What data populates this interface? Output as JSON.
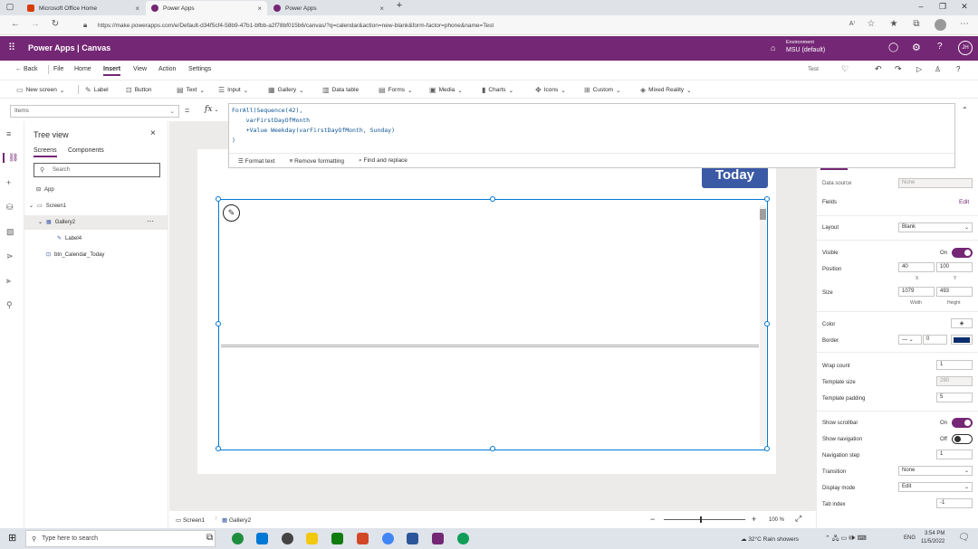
{
  "browser": {
    "tabs": [
      {
        "label": "Microsoft Office Home",
        "color": "#d83b01"
      },
      {
        "label": "Power Apps",
        "color": "#742774"
      },
      {
        "label": "Power Apps",
        "color": "#742774"
      }
    ],
    "url": "https://make.powerapps.com/e/Default-d34f5cf4-58b9-47b1-bfbb-a2f78bf015b6/canvas/?q=calendar&action=new-blank&form-factor=phone&name=Test"
  },
  "appbar": {
    "title": "Power Apps  |  Canvas",
    "environment_label": "Environment",
    "environment_name": "MSU (default)",
    "avatar": "JH"
  },
  "menu": {
    "back": "Back",
    "items": [
      "File",
      "Home",
      "Insert",
      "View",
      "Action",
      "Settings"
    ],
    "app_name": "Test"
  },
  "ribbon": [
    "New screen",
    "Label",
    "Button",
    "Text",
    "Input",
    "Gallery",
    "Data table",
    "Forms",
    "Media",
    "Charts",
    "Icons",
    "Custom",
    "Mixed Reality"
  ],
  "formula_bar": {
    "property": "Items",
    "fx": "fx",
    "code": "ForAll(Sequence(42),\n    varFirstDayOfMonth\n    +Value Weekday(varFirstDayOfMonth, Sunday)\n)",
    "tools": [
      "Format text",
      "Remove formatting",
      "Find and replace"
    ]
  },
  "tree": {
    "title": "Tree view",
    "tabs": [
      "Screens",
      "Components"
    ],
    "search_placeholder": "Search",
    "nodes": [
      "App",
      "Screen1",
      "Gallery2",
      "Label4",
      "btn_Calendar_Today"
    ]
  },
  "canvas": {
    "today_button": "Today"
  },
  "props": {
    "data_source": "Data source",
    "data_source_val": "None",
    "fields": "Fields",
    "fields_edit": "Edit",
    "layout": "Layout",
    "layout_val": "Blank",
    "visible": "Visible",
    "visible_val": "On",
    "position": "Position",
    "pos_x": "40",
    "pos_y": "100",
    "x": "X",
    "y": "Y",
    "size": "Size",
    "width": "1079",
    "height": "493",
    "w_lbl": "Width",
    "h_lbl": "Height",
    "color": "Color",
    "border": "Border",
    "border_w": "0",
    "border_color": "#0b2e6e",
    "wrap_count": "Wrap count",
    "wrap_val": "1",
    "template_size": "Template size",
    "template_size_val": "280",
    "template_padding": "Template padding",
    "template_padding_val": "5",
    "show_scrollbar": "Show scrollbar",
    "scrollbar_val": "On",
    "show_navigation": "Show navigation",
    "navigation_val": "Off",
    "navigation_step": "Navigation step",
    "nav_step_val": "1",
    "transition": "Transition",
    "transition_val": "None",
    "display_mode": "Display mode",
    "display_mode_val": "Edit",
    "tab_index": "Tab index",
    "tab_index_val": "-1"
  },
  "status": {
    "screen": "Screen1",
    "gallery": "Gallery2",
    "zoom": "100 %"
  },
  "taskbar": {
    "search": "Type here to search",
    "weather": "32°C  Rain showers",
    "lang": "ENG",
    "time": "3:54 PM",
    "date": "11/5/2022"
  }
}
